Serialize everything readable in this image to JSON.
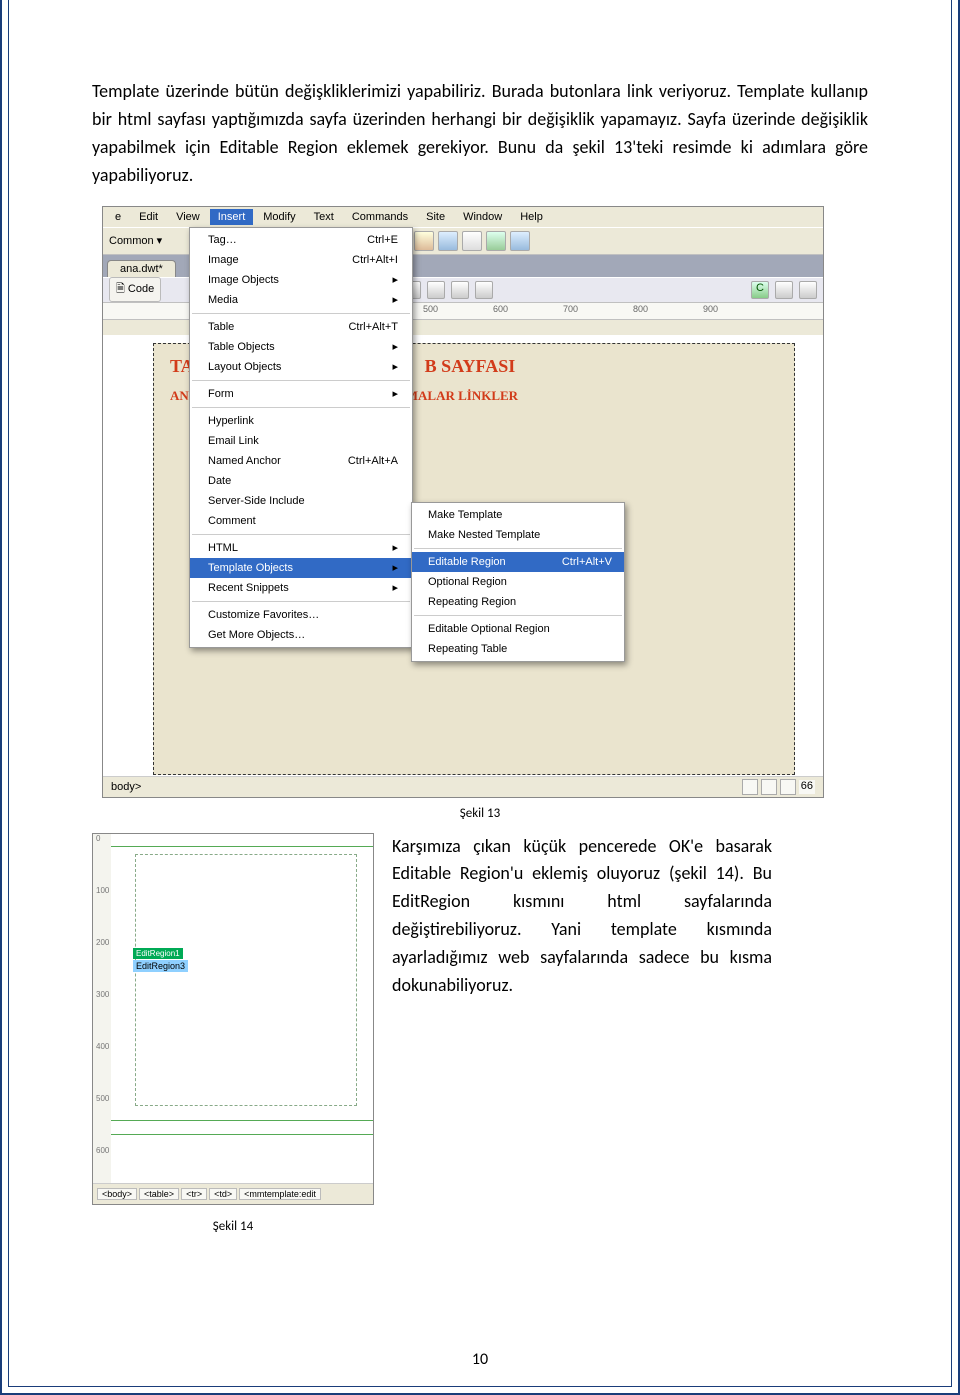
{
  "paragraph_top": "Template üzerinde bütün değişkliklerimizi yapabiliriz. Burada butonlara link veriyoruz. Template kullanıp bir html sayfası yaptığımızda sayfa üzerinden herhangi bir değişiklik yapamayız. Sayfa üzerinde değişiklik yapabilmek için Editable Region eklemek gerekiyor. Bunu da şekil 13'teki resimde ki adımlara göre yapabiliyoruz.",
  "fig13": {
    "menubar": [
      "e",
      "Edit",
      "View",
      "Insert",
      "Modify",
      "Text",
      "Commands",
      "Site",
      "Window",
      "Help"
    ],
    "menubar_hi_index": 3,
    "common_label": "Common ▾",
    "filetab": "ana.dwt*",
    "code_btn": "Code",
    "ruler_marks": [
      {
        "pos": 320,
        "label": "500"
      },
      {
        "pos": 390,
        "label": "600"
      },
      {
        "pos": 460,
        "label": "700"
      },
      {
        "pos": 530,
        "label": "800"
      },
      {
        "pos": 600,
        "label": "900"
      }
    ],
    "page_title_left": "TAR",
    "page_title_right": "B SAYFASI",
    "nav_left": "ANASA",
    "nav_right": "LIŞMALAR  LİNKLER",
    "insert_menu": [
      {
        "label": "Tag…",
        "short": "Ctrl+E"
      },
      {
        "label": "Image",
        "short": "Ctrl+Alt+I"
      },
      {
        "label": "Image Objects",
        "arrow": true
      },
      {
        "label": "Media",
        "arrow": true
      },
      {
        "sep": true
      },
      {
        "label": "Table",
        "short": "Ctrl+Alt+T"
      },
      {
        "label": "Table Objects",
        "arrow": true
      },
      {
        "label": "Layout Objects",
        "arrow": true
      },
      {
        "sep": true
      },
      {
        "label": "Form",
        "arrow": true
      },
      {
        "sep": true
      },
      {
        "label": "Hyperlink"
      },
      {
        "label": "Email Link"
      },
      {
        "label": "Named Anchor",
        "short": "Ctrl+Alt+A"
      },
      {
        "label": "Date"
      },
      {
        "label": "Server-Side Include"
      },
      {
        "label": "Comment"
      },
      {
        "sep": true
      },
      {
        "label": "HTML",
        "arrow": true
      },
      {
        "label": "Template Objects",
        "arrow": true,
        "hi": true
      },
      {
        "label": "Recent Snippets",
        "arrow": true
      },
      {
        "sep": true
      },
      {
        "label": "Customize Favorites…"
      },
      {
        "label": "Get More Objects…"
      }
    ],
    "submenu": [
      {
        "label": "Make Template"
      },
      {
        "label": "Make Nested Template"
      },
      {
        "sep": true
      },
      {
        "label": "Editable Region",
        "short": "Ctrl+Alt+V",
        "hi": true
      },
      {
        "label": "Optional Region"
      },
      {
        "label": "Repeating Region"
      },
      {
        "sep": true
      },
      {
        "label": "Editable Optional Region"
      },
      {
        "label": "Repeating Table"
      }
    ],
    "status_left": "body>",
    "status_right_num": "66"
  },
  "caption_fig13": "Şekil 13",
  "side_para": "Karşımıza çıkan küçük pencerede OK'e basarak Editable Region'u eklemiş oluyoruz (şekil 14). Bu EditRegion kısmını html sayfalarında değiştirebiliyoruz. Yani template kısmında ayarladığımız web sayfalarında sadece bu kısma dokunabiliyoruz.",
  "fig14": {
    "vruler": [
      "0",
      "100",
      "200",
      "300",
      "400",
      "500",
      "600"
    ],
    "region_tab": "EditRegion1",
    "region_label": "EditRegion3",
    "tags": [
      "<body>",
      "<table>",
      "<tr>",
      "<td>",
      "<mmtemplate:edit"
    ]
  },
  "caption_fig14": "Şekil 14",
  "page_number": "10"
}
